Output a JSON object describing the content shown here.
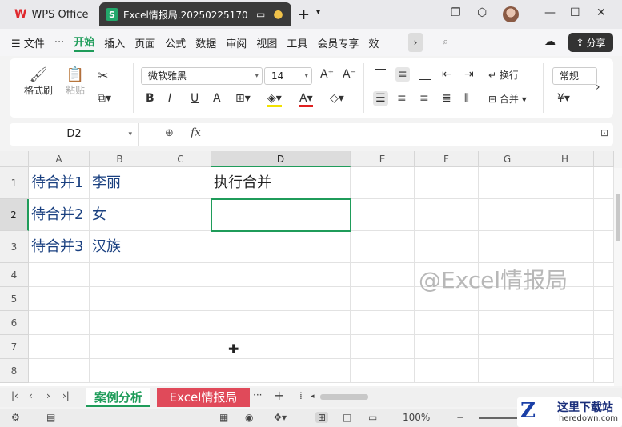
{
  "titlebar": {
    "app_tab": "WPS Office",
    "doc_tab": "Excel情报局.20250225170",
    "doc_badge": "S"
  },
  "menubar": {
    "items": [
      "文件",
      "···",
      "开始",
      "插入",
      "页面",
      "公式",
      "数据",
      "审阅",
      "视图",
      "工具",
      "会员专享",
      "效"
    ],
    "active": "开始",
    "share_label": "分享"
  },
  "ribbon": {
    "format_painter": "格式刷",
    "paste": "粘贴",
    "font_name": "微软雅黑",
    "font_size": "14",
    "wrap_text": "换行",
    "merge": "合并",
    "number_format": "常规",
    "currency_symbol": "¥"
  },
  "formula_bar": {
    "name_box": "D2",
    "fx_label": "fx",
    "content": ""
  },
  "grid": {
    "columns": [
      "A",
      "B",
      "C",
      "D",
      "E",
      "F",
      "G",
      "H"
    ],
    "rows": [
      "1",
      "2",
      "3",
      "4",
      "5",
      "6",
      "7",
      "8"
    ],
    "cells": {
      "A1": "待合并1",
      "B1": "李丽",
      "D1": "执行合并",
      "A2": "待合并2",
      "B2": "女",
      "A3": "待合并3",
      "B3": "汉族"
    },
    "selected_cell": "D2",
    "watermark": "@Excel情报局"
  },
  "sheets": {
    "active": "案例分析",
    "other": "Excel情报局"
  },
  "statusbar": {
    "zoom": "100%"
  },
  "site_logo": {
    "cn": "这里下载站",
    "en": "heredown.com"
  },
  "colors": {
    "accent": "#1f9c5a",
    "sheet2_bg": "#e04a5a",
    "cell_text": "#1a4080"
  }
}
